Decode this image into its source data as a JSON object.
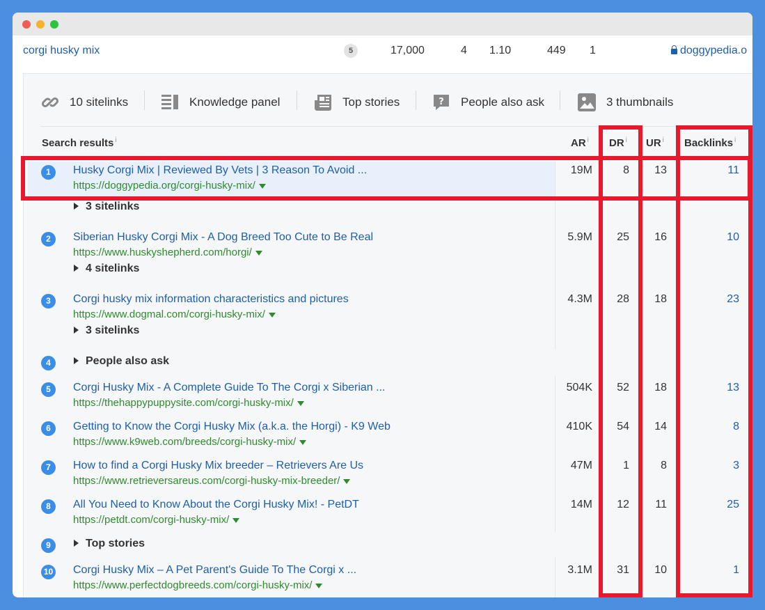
{
  "keyword_row": {
    "keyword": "corgi husky mix",
    "badge": "5",
    "volume": "17,000",
    "kd": "4",
    "cpc": "1.10",
    "traffic": "449",
    "position": "1",
    "domain": "doggypedia.o"
  },
  "features": [
    {
      "label": "10 sitelinks",
      "icon": "link-icon"
    },
    {
      "label": "Knowledge panel",
      "icon": "knowledge-panel-icon"
    },
    {
      "label": "Top stories",
      "icon": "newspaper-icon"
    },
    {
      "label": "People also ask",
      "icon": "question-icon"
    },
    {
      "label": "3 thumbnails",
      "icon": "image-icon"
    }
  ],
  "table": {
    "headers": {
      "results": "Search results",
      "ar": "AR",
      "dr": "DR",
      "ur": "UR",
      "backlinks": "Backlinks",
      "info": "i"
    },
    "rows": [
      {
        "pos": "1",
        "title": "Husky Corgi Mix | Reviewed By Vets | 3 Reason To Avoid ...",
        "url": "https://doggypedia.org/corgi-husky-mix/",
        "ar": "19M",
        "dr": "8",
        "ur": "13",
        "backlinks": "11",
        "sitelinks": "3 sitelinks"
      },
      {
        "pos": "2",
        "title": "Siberian Husky Corgi Mix - A Dog Breed Too Cute to Be Real",
        "url": "https://www.huskyshepherd.com/horgi/",
        "ar": "5.9M",
        "dr": "25",
        "ur": "16",
        "backlinks": "10",
        "sitelinks": "4 sitelinks"
      },
      {
        "pos": "3",
        "title": "Corgi husky mix information characteristics and pictures",
        "url": "https://www.dogmal.com/corgi-husky-mix/",
        "ar": "4.3M",
        "dr": "28",
        "ur": "18",
        "backlinks": "23",
        "sitelinks": "3 sitelinks"
      },
      {
        "pos": "4",
        "feature": "People also ask"
      },
      {
        "pos": "5",
        "title": "Corgi Husky Mix - A Complete Guide To The Corgi x Siberian ...",
        "url": "https://thehappypuppysite.com/corgi-husky-mix/",
        "ar": "504K",
        "dr": "52",
        "ur": "18",
        "backlinks": "13"
      },
      {
        "pos": "6",
        "title": "Getting to Know the Corgi Husky Mix (a.k.a. the Horgi) - K9 Web",
        "url": "https://www.k9web.com/breeds/corgi-husky-mix/",
        "ar": "410K",
        "dr": "54",
        "ur": "14",
        "backlinks": "8"
      },
      {
        "pos": "7",
        "title": "How to find a Corgi Husky Mix breeder – Retrievers Are Us",
        "url": "https://www.retrieversareus.com/corgi-husky-mix-breeder/",
        "ar": "47M",
        "dr": "1",
        "ur": "8",
        "backlinks": "3"
      },
      {
        "pos": "8",
        "title": "All You Need to Know About the Corgi Husky Mix! - PetDT",
        "url": "https://petdt.com/corgi-husky-mix/",
        "ar": "14M",
        "dr": "12",
        "ur": "11",
        "backlinks": "25"
      },
      {
        "pos": "9",
        "feature": "Top stories"
      },
      {
        "pos": "10",
        "title": "Corgi Husky Mix – A Pet Parent's Guide To The Corgi x ...",
        "url": "https://www.perfectdogbreeds.com/corgi-husky-mix/",
        "ar": "3.1M",
        "dr": "31",
        "ur": "10",
        "backlinks": "1"
      }
    ]
  },
  "colors": {
    "highlight_box": "#e8192c",
    "link": "#1f5eab",
    "url": "#2e8b2e",
    "position_badge": "#3a8ee8",
    "background": "#4a8fe0"
  }
}
